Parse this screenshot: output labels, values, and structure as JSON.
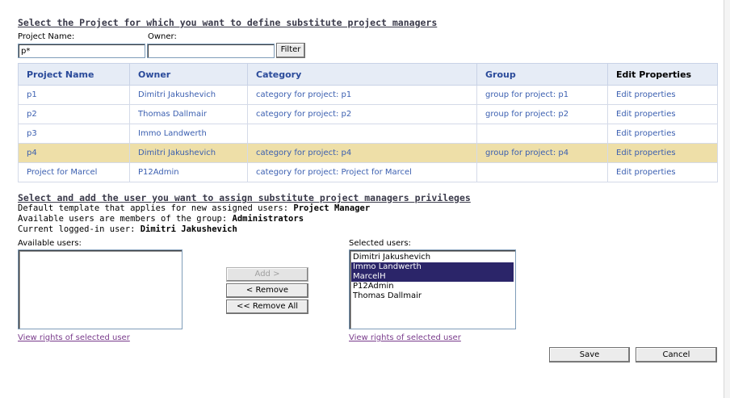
{
  "project_section": {
    "title": "Select the Project for which you want to define substitute project managers",
    "project_name_label": "Project Name:",
    "owner_label": "Owner:",
    "project_name_value": "p*",
    "owner_value": "",
    "filter_label": "Filter"
  },
  "table": {
    "headers": [
      "Project Name",
      "Owner",
      "Category",
      "Group",
      "Edit Properties"
    ],
    "rows": [
      {
        "name": "p1",
        "owner": "Dimitri Jakushevich",
        "category": "category for project: p1",
        "group": "group for project: p1",
        "edit": "Edit properties"
      },
      {
        "name": "p2",
        "owner": "Thomas Dallmair",
        "category": "category for project: p2",
        "group": "group for project: p2",
        "edit": "Edit properties"
      },
      {
        "name": "p3",
        "owner": "Immo Landwerth",
        "category": "",
        "group": "",
        "edit": "Edit properties"
      },
      {
        "name": "p4",
        "owner": "Dimitri Jakushevich",
        "category": "category for project: p4",
        "group": "group for project: p4",
        "edit": "Edit properties"
      },
      {
        "name": "Project for Marcel",
        "owner": "P12Admin",
        "category": "category for project: Project for Marcel",
        "group": "",
        "edit": "Edit properties"
      }
    ]
  },
  "user_section": {
    "title": "Select and add the user you want to assign substitute project managers privileges",
    "template_text": "Default template that applies for new assigned users: ",
    "template_value": "Project Manager",
    "group_text": "Available users are members of the group: ",
    "group_value": "Administrators",
    "current_text": "Current logged-in user: ",
    "current_value": "Dimitri Jakushevich",
    "available_label": "Available users:",
    "selected_label": "Selected users:",
    "available_users": [],
    "selected_users": [
      "Dimitri Jakushevich",
      "Immo Landwerth",
      "MarcelH",
      "P12Admin",
      "Thomas Dallmair"
    ],
    "add_label": "Add >",
    "remove_label": "< Remove",
    "remove_all_label": "<< Remove All",
    "view_rights_label": "View rights of selected user"
  },
  "footer": {
    "save_label": "Save",
    "cancel_label": "Cancel"
  },
  "colors": {
    "highlight_row": "#eedfa8",
    "selected_item": "#2b2569",
    "link": "#3b5fb0"
  }
}
